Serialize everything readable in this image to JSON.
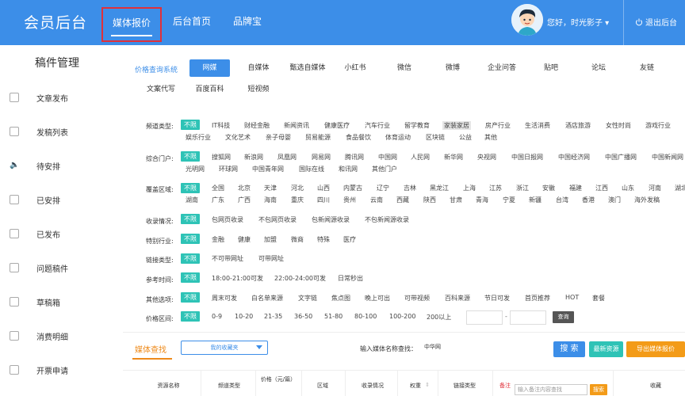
{
  "header": {
    "logo": "会员后台",
    "nav": [
      "媒体报价",
      "后台首页",
      "品牌宝"
    ],
    "greeting": "您好，时光影子 ▾",
    "logout": "退出后台"
  },
  "annotation": "1",
  "sidebar": {
    "title": "稿件管理",
    "items": [
      {
        "label": "文章发布",
        "icon": "document-icon"
      },
      {
        "label": "发稿列表",
        "icon": "list-icon"
      },
      {
        "label": "待安排",
        "icon": "speaker-icon"
      },
      {
        "label": "已安排",
        "icon": "folder-icon"
      },
      {
        "label": "已发布",
        "icon": "published-icon"
      },
      {
        "label": "问题稿件",
        "icon": "warning-doc-icon"
      },
      {
        "label": "草稿箱",
        "icon": "draft-icon"
      },
      {
        "label": "消费明细",
        "icon": "money-icon"
      },
      {
        "label": "开票申请",
        "icon": "invoice-icon"
      }
    ]
  },
  "categories": {
    "label": "价格查询系统",
    "row1": [
      "网媒",
      "自媒体",
      "甄选自媒体",
      "小红书",
      "微信",
      "微博",
      "企业问答",
      "贴吧",
      "论坛",
      "友链"
    ],
    "row2": [
      "文案代写",
      "百度百科",
      "短视频"
    ]
  },
  "filters": {
    "unlimited": "不限",
    "channel": {
      "label": "频道类型:",
      "row1": [
        "IT科技",
        "财经金融",
        "新闻资讯",
        "健康医疗",
        "汽车行业",
        "留学教育",
        "家装家居",
        "房产行业",
        "生活消费",
        "酒店旅游",
        "女性时尚",
        "游戏行业"
      ],
      "row2": [
        "娱乐行业",
        "文化艺术",
        "亲子母婴",
        "贸易能源",
        "食品餐饮",
        "体育运动",
        "区块链",
        "公益",
        "其他"
      ]
    },
    "portal": {
      "label": "综合门户:",
      "row1": [
        "搜狐网",
        "新浪网",
        "凤凰网",
        "网易网",
        "腾讯网",
        "中国网",
        "人民网",
        "新华网",
        "央视网",
        "中国日报网",
        "中国经济网",
        "中国广播网",
        "中国新闻网"
      ],
      "row2": [
        "光明网",
        "环球网",
        "中国青年网",
        "国际在线",
        "和讯网",
        "其他门户"
      ]
    },
    "region": {
      "label": "覆盖区域:",
      "row1": [
        "全国",
        "北京",
        "天津",
        "河北",
        "山西",
        "内蒙古",
        "辽宁",
        "吉林",
        "黑龙江",
        "上海",
        "江苏",
        "浙江",
        "安徽",
        "福建",
        "江西",
        "山东",
        "河南",
        "湖北"
      ],
      "row2": [
        "湖南",
        "广东",
        "广西",
        "海南",
        "重庆",
        "四川",
        "贵州",
        "云南",
        "西藏",
        "陕西",
        "甘肃",
        "青海",
        "宁夏",
        "新疆",
        "台湾",
        "香港",
        "澳门",
        "海外发稿"
      ]
    },
    "inclusion": {
      "label": "收录情况:",
      "options": [
        "包网页收录",
        "不包网页收录",
        "包新闻源收录",
        "不包新闻源收录"
      ]
    },
    "special": {
      "label": "特别行业:",
      "options": [
        "金融",
        "健康",
        "加盟",
        "微商",
        "特殊",
        "医疗"
      ]
    },
    "link": {
      "label": "链接类型:",
      "options": [
        "不可带网址",
        "可带网址"
      ]
    },
    "time": {
      "label": "参考时间:",
      "options": [
        "18:00-21:00可发",
        "22:00-24:00可发",
        "日常秒出"
      ]
    },
    "other": {
      "label": "其他选项:",
      "options": [
        "周末可发",
        "白名单来源",
        "文字链",
        "焦点图",
        "晚上可出",
        "可带视频",
        "百科来源",
        "节日可发",
        "首页推荐",
        "HOT",
        "套餐"
      ]
    },
    "price": {
      "label": "价格区间:",
      "options": [
        "0-9",
        "10-20",
        "21-35",
        "36-50",
        "51-80",
        "80-100",
        "100-200",
        "200以上"
      ],
      "dash": "-",
      "query": "查询"
    }
  },
  "search": {
    "title": "媒体查找",
    "favorites": "我的收藏夹",
    "name_label": "输入媒体名称查找：",
    "name_value": "中华网",
    "search_btn": "搜 索",
    "latest_btn": "最新资源",
    "export_btn": "导出媒体报价"
  },
  "table": {
    "headers": [
      "资源名称",
      "频道类型",
      "价格（元/篇）",
      "区域",
      "收录情况",
      "权重",
      "链接类型",
      "备注",
      "收藏"
    ],
    "note_placeholder": "输入备注内容查找",
    "note_btn": "搜索"
  },
  "colors": {
    "brand": "#3c8ee8",
    "teal": "#2ec3b6",
    "orange": "#f39b18",
    "red": "#e0303a"
  }
}
